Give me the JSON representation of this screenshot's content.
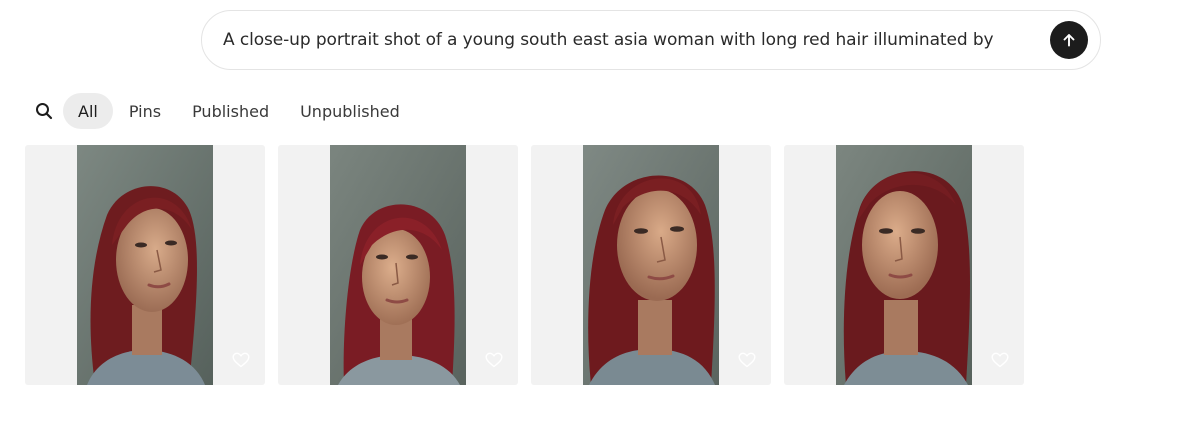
{
  "prompt": {
    "text": "A close-up portrait shot of a young south east asia woman with long red hair illuminated by",
    "submit_icon": "arrow-up-icon"
  },
  "filters": {
    "search_icon": "search-icon",
    "tabs": [
      {
        "label": "All",
        "active": true
      },
      {
        "label": "Pins",
        "active": false
      },
      {
        "label": "Published",
        "active": false
      },
      {
        "label": "Unpublished",
        "active": false
      }
    ]
  },
  "gallery": {
    "items": [
      {
        "favorite_icon": "heart-outline-icon"
      },
      {
        "favorite_icon": "heart-outline-icon"
      },
      {
        "favorite_icon": "heart-outline-icon"
      },
      {
        "favorite_icon": "heart-outline-icon"
      }
    ]
  },
  "colors": {
    "submit_bg": "#1c1c1c",
    "active_tab_bg": "#ececec",
    "card_bg": "#f2f2f2",
    "photo_bg": "#6f7a74",
    "hair": "#7a1f22",
    "skin": "#c89878",
    "shirt": "#7c8c96"
  }
}
